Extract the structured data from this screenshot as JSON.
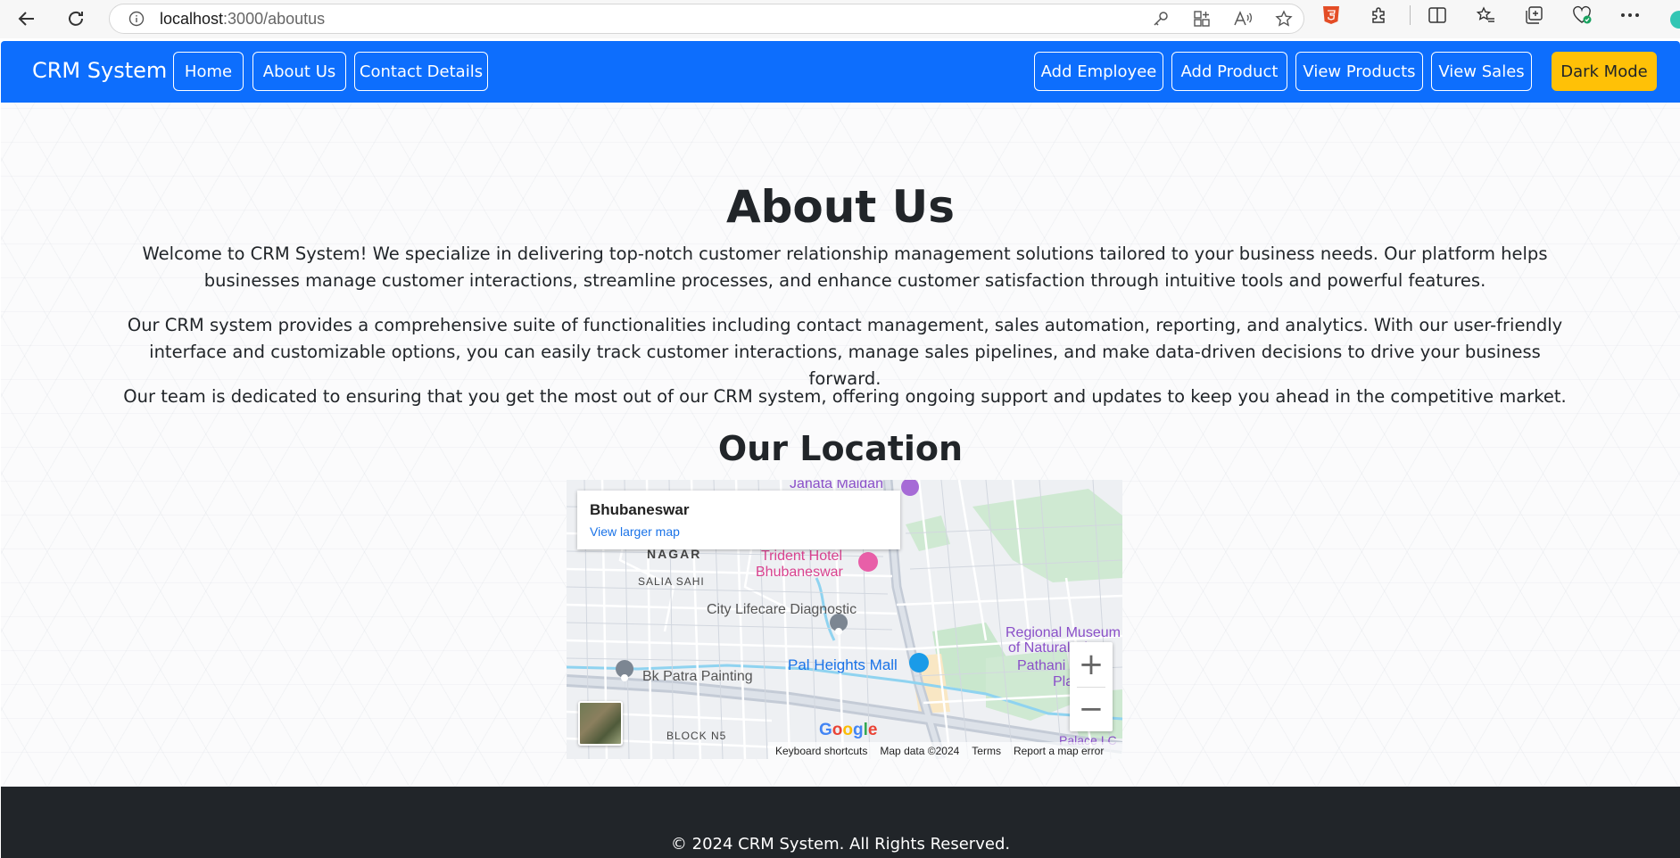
{
  "browser": {
    "url_host": "localhost",
    "url_path": ":3000/aboutus"
  },
  "navbar": {
    "brand": "CRM System",
    "left_links": [
      "Home",
      "About Us",
      "Contact Details"
    ],
    "right_links": [
      "Add Employee",
      "Add Product",
      "View Products",
      "View Sales"
    ],
    "dark_mode_label": "Dark Mode",
    "colors": {
      "background": "#0d6efd",
      "dark_mode_button": "#ffc107"
    }
  },
  "main": {
    "title": "About Us",
    "paragraphs": [
      "Welcome to CRM System! We specialize in delivering top-notch customer relationship management solutions tailored to your business needs. Our platform helps businesses manage customer interactions, streamline processes, and enhance customer satisfaction through intuitive tools and powerful features.",
      "Our CRM system provides a comprehensive suite of functionalities including contact management, sales automation, reporting, and analytics. With our user-friendly interface and customizable options, you can easily track customer interactions, manage sales pipelines, and make data-driven decisions to drive your business forward.",
      "Our team is dedicated to ensuring that you get the most out of our CRM system, offering ongoing support and updates to keep you ahead in the competitive market."
    ],
    "location_title": "Our Location"
  },
  "map": {
    "place_name": "Bhubaneswar",
    "view_larger": "View larger map",
    "labels": {
      "janata_maidan": "Janata Maidan",
      "nagar": "NAGAR",
      "saliasahi": "SALIA SAHI",
      "trident1": "Trident Hotel",
      "trident2": "Bhubaneswar",
      "city_lifecare": "City Lifecare Diagnostic",
      "regional1": "Regional Museum",
      "regional2": "of Natural Hi",
      "pal_heights": "Pal Heights Mall",
      "bk_patra": "Bk Patra Painting",
      "pathani1": "Pathani Sa",
      "pathani2": "Pla",
      "block_n5": "BLOCK N5",
      "palace": "Palace I C"
    },
    "zoom_in": "+",
    "zoom_out": "−",
    "google": [
      "G",
      "o",
      "o",
      "g",
      "l",
      "e"
    ],
    "footer": {
      "keyboard": "Keyboard shortcuts",
      "map_data": "Map data ©2024",
      "terms": "Terms",
      "report": "Report a map error"
    }
  },
  "footer": {
    "text": "© 2024 CRM System. All Rights Reserved."
  }
}
